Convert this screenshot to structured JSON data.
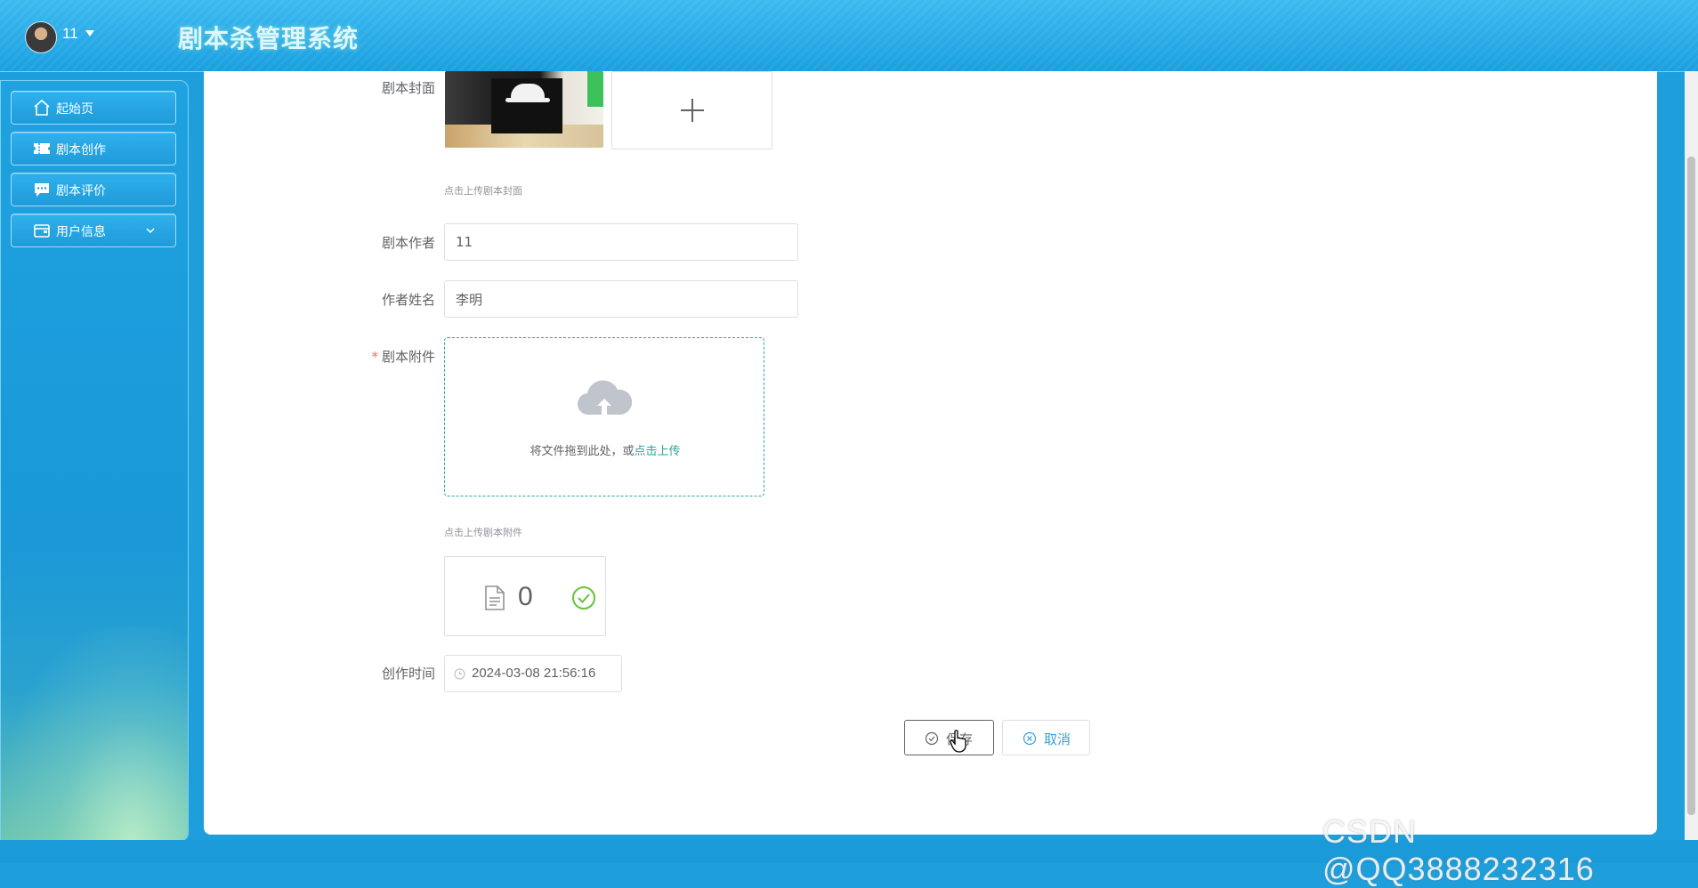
{
  "header": {
    "user_name": "11",
    "app_title": "剧本杀管理系统"
  },
  "sidebar": {
    "items": [
      {
        "label": "起始页",
        "icon": "home-icon"
      },
      {
        "label": "剧本创作",
        "icon": "ticket-icon"
      },
      {
        "label": "剧本评价",
        "icon": "comment-icon"
      },
      {
        "label": "用户信息",
        "icon": "wallet-icon",
        "has_submenu": true
      }
    ]
  },
  "form": {
    "cover": {
      "label": "剧本封面",
      "hint": "点击上传剧本封面"
    },
    "author_account": {
      "label": "剧本作者",
      "value": "11"
    },
    "author_name": {
      "label": "作者姓名",
      "value": "李明"
    },
    "attachment": {
      "label": "剧本附件",
      "required_mark": "*",
      "drop_text": "将文件拖到此处，或",
      "drop_link": "点击上传",
      "hint": "点击上传剧本附件",
      "file_count": "0",
      "status": "uploaded"
    },
    "create_time": {
      "label": "创作时间",
      "value": "2024-03-08 21:56:16"
    }
  },
  "buttons": {
    "save_label": "保存",
    "cancel_label": "取消"
  },
  "watermark": "CSDN @QQ3888232316",
  "colors": {
    "accent": "#1e9fdc",
    "link": "#2ba59a",
    "success": "#67c23a",
    "required": "#f56c6c"
  }
}
